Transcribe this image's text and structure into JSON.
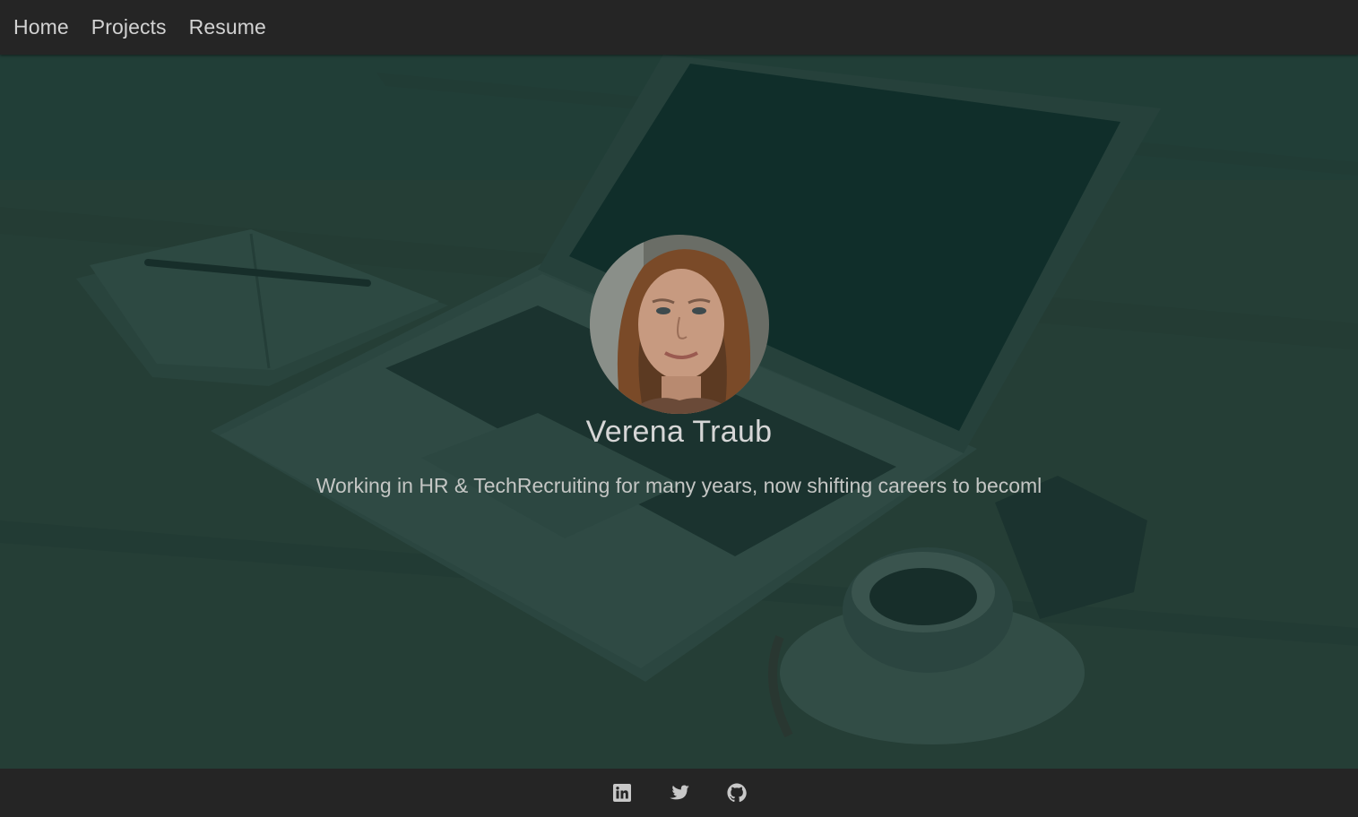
{
  "nav": {
    "items": [
      {
        "label": "Home"
      },
      {
        "label": "Projects"
      },
      {
        "label": "Resume"
      }
    ]
  },
  "hero": {
    "name": "Verena Traub",
    "tagline": "Working in HR & TechRecruiting for many years, now shifting careers to becoml"
  },
  "footer": {
    "social": [
      {
        "icon": "linkedin-icon"
      },
      {
        "icon": "twitter-icon"
      },
      {
        "icon": "github-icon"
      }
    ]
  },
  "colors": {
    "nav_bg": "#252525",
    "overlay": "#123430",
    "text": "#d6d6d6"
  }
}
